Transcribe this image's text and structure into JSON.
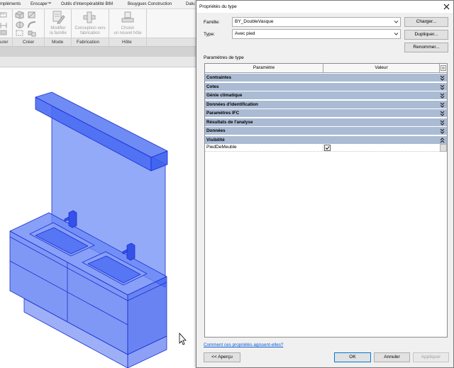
{
  "ribbon": {
    "tabs": [
      "mpléments",
      "Enscape™",
      "Outils d'interopérabilité BIM",
      "Bouygues Construction",
      "Dalu"
    ],
    "tools": {
      "edit_family": {
        "line1": "Modifier",
        "line2": "la famille",
        "icon": "edit-family-icon",
        "enabled": false
      },
      "design_to_fabrication": {
        "line1": "Conception vers",
        "line2": "fabrication",
        "icon": "fabrication-icon",
        "enabled": false
      },
      "pick_new_host": {
        "line1": "Choisir",
        "line2": "un nouvel hôte",
        "icon": "pick-host-icon",
        "enabled": false
      }
    },
    "panels": [
      "urer",
      "Créer",
      "Mode",
      "Fabrication",
      "Hôte"
    ]
  },
  "icons": {
    "close": "close-icon",
    "dropdown": "chevron-down-icon",
    "group_collapsed": "chevron-double-down-icon",
    "group_expanded": "chevron-double-up-icon",
    "checkbox_checked": "check-icon",
    "cursor": "mouse-cursor-icon"
  },
  "colors": {
    "group_header": "#abbbd3",
    "link": "#0a5bd6",
    "model_blue": "#3f62ee"
  },
  "dialog": {
    "title": "Propriétés du type",
    "family": {
      "label": "Famille:",
      "value": "BY_DoubleVasque"
    },
    "type": {
      "label": "Type:",
      "value": "Avec pied"
    },
    "buttons": {
      "load": "Charger...",
      "duplicate": "Dupliquer...",
      "rename": "Renommer...",
      "preview": "<< Aperçu",
      "ok": "OK",
      "cancel": "Annuler",
      "apply": "Appliquer"
    },
    "apply_enabled": false,
    "params_label": "Paramètres de type",
    "table": {
      "headers": {
        "parameter": "Paramètre",
        "value": "Valeur"
      },
      "groups": [
        {
          "name": "Contraintes",
          "expanded": false
        },
        {
          "name": "Cotes",
          "expanded": false
        },
        {
          "name": "Génie climatique",
          "expanded": false
        },
        {
          "name": "Données d'identification",
          "expanded": false
        },
        {
          "name": "Paramètres IFC",
          "expanded": false
        },
        {
          "name": "Résultats de l'analyse",
          "expanded": false
        },
        {
          "name": "Données",
          "expanded": false
        },
        {
          "name": "Visibilité",
          "expanded": true
        }
      ],
      "rows": [
        {
          "name": "PiedDeMeuble",
          "checked": true
        }
      ]
    },
    "help_link": "Comment ces propriétés agissent-elles?"
  }
}
